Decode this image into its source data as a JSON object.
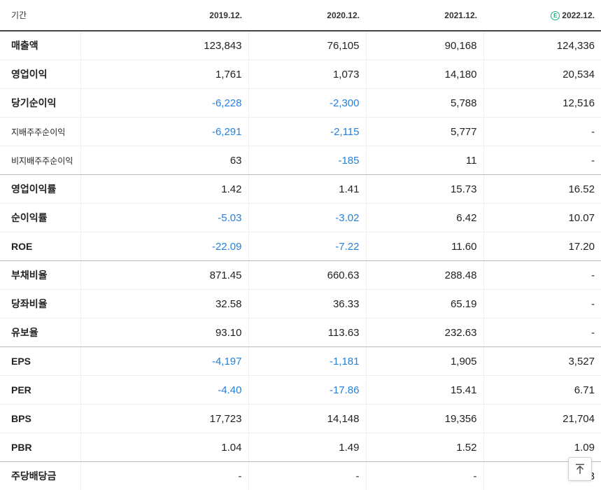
{
  "table": {
    "header": {
      "label": "기간",
      "periods": [
        "2019.12.",
        "2020.12.",
        "2021.12.",
        "2022.12."
      ],
      "estimate_mark": "E"
    },
    "rows": [
      {
        "label": "매출액",
        "values": [
          "123,843",
          "76,105",
          "90,168",
          "124,336"
        ]
      },
      {
        "label": "영업이익",
        "values": [
          "1,761",
          "1,073",
          "14,180",
          "20,534"
        ]
      },
      {
        "label": "당기순이익",
        "values": [
          "-6,228",
          "-2,300",
          "5,788",
          "12,516"
        ]
      },
      {
        "label": "지배주주순이익",
        "values": [
          "-6,291",
          "-2,115",
          "5,777",
          "-"
        ]
      },
      {
        "label": "비지배주주순이익",
        "values": [
          "63",
          "-185",
          "11",
          "-"
        ]
      },
      {
        "label": "영업이익률",
        "values": [
          "1.42",
          "1.41",
          "15.73",
          "16.52"
        ]
      },
      {
        "label": "순이익률",
        "values": [
          "-5.03",
          "-3.02",
          "6.42",
          "10.07"
        ]
      },
      {
        "label": "ROE",
        "values": [
          "-22.09",
          "-7.22",
          "11.60",
          "17.20"
        ]
      },
      {
        "label": "부채비율",
        "values": [
          "871.45",
          "660.63",
          "288.48",
          "-"
        ]
      },
      {
        "label": "당좌비율",
        "values": [
          "32.58",
          "36.33",
          "65.19",
          "-"
        ]
      },
      {
        "label": "유보율",
        "values": [
          "93.10",
          "113.63",
          "232.63",
          "-"
        ]
      },
      {
        "label": "EPS",
        "values": [
          "-4,197",
          "-1,181",
          "1,905",
          "3,527"
        ]
      },
      {
        "label": "PER",
        "values": [
          "-4.40",
          "-17.86",
          "15.41",
          "6.71"
        ]
      },
      {
        "label": "BPS",
        "values": [
          "17,723",
          "14,148",
          "19,356",
          "21,704"
        ]
      },
      {
        "label": "PBR",
        "values": [
          "1.04",
          "1.49",
          "1.52",
          "1.09"
        ]
      },
      {
        "label": "주당배당금",
        "values": [
          "-",
          "-",
          "-",
          "3"
        ]
      }
    ]
  },
  "colors": {
    "negative": "#2680d9",
    "estimate": "#17b27b",
    "text": "#222222"
  },
  "top_button": {
    "icon": "arrow-up-to-top-icon"
  }
}
